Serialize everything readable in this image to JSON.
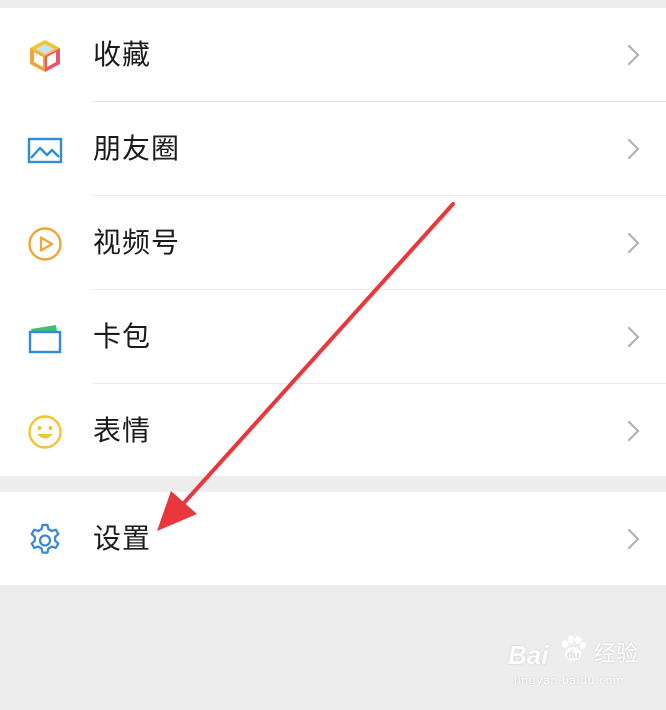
{
  "menu": {
    "items": [
      {
        "label": "收藏",
        "icon": "favorites-cube-icon"
      },
      {
        "label": "朋友圈",
        "icon": "moments-picture-icon"
      },
      {
        "label": "视频号",
        "icon": "channels-play-icon"
      },
      {
        "label": "卡包",
        "icon": "card-wallet-icon"
      },
      {
        "label": "表情",
        "icon": "sticker-smiley-icon"
      }
    ],
    "settings": {
      "label": "设置",
      "icon": "gear-icon"
    }
  },
  "watermark": {
    "brand": "Bai",
    "suffix": "经验",
    "url": "jingyan.baidu.com"
  },
  "colors": {
    "background": "#ededed",
    "panel": "#ffffff",
    "text": "#1b1b1b",
    "chevron": "#b2b2b2",
    "divider": "#eaeaea",
    "arrow": "#e8383d",
    "moments_blue": "#2f8cd8",
    "channels_orange": "#f0a43a",
    "sticker_yellow": "#f4c430",
    "settings_blue": "#3b84d6"
  }
}
